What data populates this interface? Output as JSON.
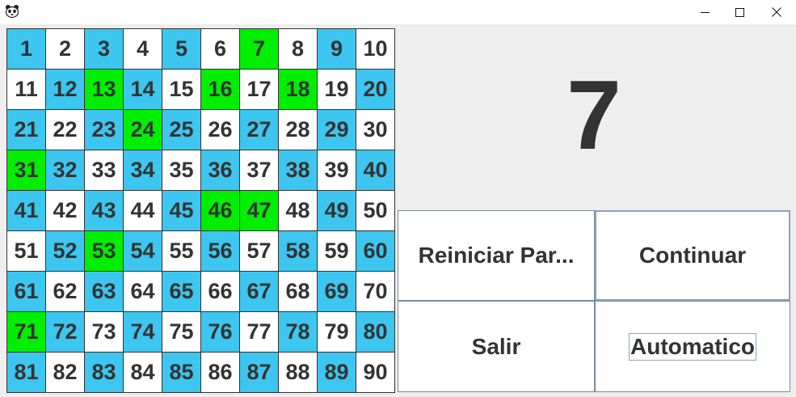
{
  "window": {
    "app_icon": "panda-icon",
    "minimize_icon": "minimize-icon",
    "maximize_icon": "maximize-icon",
    "close_icon": "close-icon"
  },
  "colors": {
    "called": "#00ee00",
    "blue": "#3dc6ef",
    "white": "#ffffff",
    "text": "#333333"
  },
  "board": {
    "cells": [
      {
        "n": "1",
        "s": "blue"
      },
      {
        "n": "2",
        "s": "white"
      },
      {
        "n": "3",
        "s": "blue"
      },
      {
        "n": "4",
        "s": "white"
      },
      {
        "n": "5",
        "s": "blue"
      },
      {
        "n": "6",
        "s": "white"
      },
      {
        "n": "7",
        "s": "called"
      },
      {
        "n": "8",
        "s": "white"
      },
      {
        "n": "9",
        "s": "blue"
      },
      {
        "n": "10",
        "s": "white"
      },
      {
        "n": "11",
        "s": "white"
      },
      {
        "n": "12",
        "s": "blue"
      },
      {
        "n": "13",
        "s": "called"
      },
      {
        "n": "14",
        "s": "blue"
      },
      {
        "n": "15",
        "s": "white"
      },
      {
        "n": "16",
        "s": "called"
      },
      {
        "n": "17",
        "s": "white"
      },
      {
        "n": "18",
        "s": "called"
      },
      {
        "n": "19",
        "s": "white"
      },
      {
        "n": "20",
        "s": "blue"
      },
      {
        "n": "21",
        "s": "blue"
      },
      {
        "n": "22",
        "s": "white"
      },
      {
        "n": "23",
        "s": "blue"
      },
      {
        "n": "24",
        "s": "called"
      },
      {
        "n": "25",
        "s": "blue"
      },
      {
        "n": "26",
        "s": "white"
      },
      {
        "n": "27",
        "s": "blue"
      },
      {
        "n": "28",
        "s": "white"
      },
      {
        "n": "29",
        "s": "blue"
      },
      {
        "n": "30",
        "s": "white"
      },
      {
        "n": "31",
        "s": "called"
      },
      {
        "n": "32",
        "s": "blue"
      },
      {
        "n": "33",
        "s": "white"
      },
      {
        "n": "34",
        "s": "blue"
      },
      {
        "n": "35",
        "s": "white"
      },
      {
        "n": "36",
        "s": "blue"
      },
      {
        "n": "37",
        "s": "white"
      },
      {
        "n": "38",
        "s": "blue"
      },
      {
        "n": "39",
        "s": "white"
      },
      {
        "n": "40",
        "s": "blue"
      },
      {
        "n": "41",
        "s": "blue"
      },
      {
        "n": "42",
        "s": "white"
      },
      {
        "n": "43",
        "s": "blue"
      },
      {
        "n": "44",
        "s": "white"
      },
      {
        "n": "45",
        "s": "blue"
      },
      {
        "n": "46",
        "s": "called"
      },
      {
        "n": "47",
        "s": "called"
      },
      {
        "n": "48",
        "s": "white"
      },
      {
        "n": "49",
        "s": "blue"
      },
      {
        "n": "50",
        "s": "white"
      },
      {
        "n": "51",
        "s": "white"
      },
      {
        "n": "52",
        "s": "blue"
      },
      {
        "n": "53",
        "s": "called"
      },
      {
        "n": "54",
        "s": "blue"
      },
      {
        "n": "55",
        "s": "white"
      },
      {
        "n": "56",
        "s": "blue"
      },
      {
        "n": "57",
        "s": "white"
      },
      {
        "n": "58",
        "s": "blue"
      },
      {
        "n": "59",
        "s": "white"
      },
      {
        "n": "60",
        "s": "blue"
      },
      {
        "n": "61",
        "s": "blue"
      },
      {
        "n": "62",
        "s": "white"
      },
      {
        "n": "63",
        "s": "blue"
      },
      {
        "n": "64",
        "s": "white"
      },
      {
        "n": "65",
        "s": "blue"
      },
      {
        "n": "66",
        "s": "white"
      },
      {
        "n": "67",
        "s": "blue"
      },
      {
        "n": "68",
        "s": "white"
      },
      {
        "n": "69",
        "s": "blue"
      },
      {
        "n": "70",
        "s": "white"
      },
      {
        "n": "71",
        "s": "called"
      },
      {
        "n": "72",
        "s": "blue"
      },
      {
        "n": "73",
        "s": "white"
      },
      {
        "n": "74",
        "s": "blue"
      },
      {
        "n": "75",
        "s": "white"
      },
      {
        "n": "76",
        "s": "blue"
      },
      {
        "n": "77",
        "s": "white"
      },
      {
        "n": "78",
        "s": "blue"
      },
      {
        "n": "79",
        "s": "white"
      },
      {
        "n": "80",
        "s": "blue"
      },
      {
        "n": "81",
        "s": "blue"
      },
      {
        "n": "82",
        "s": "white"
      },
      {
        "n": "83",
        "s": "blue"
      },
      {
        "n": "84",
        "s": "white"
      },
      {
        "n": "85",
        "s": "blue"
      },
      {
        "n": "86",
        "s": "white"
      },
      {
        "n": "87",
        "s": "blue"
      },
      {
        "n": "88",
        "s": "white"
      },
      {
        "n": "89",
        "s": "blue"
      },
      {
        "n": "90",
        "s": "white"
      }
    ]
  },
  "current_number": "7",
  "buttons": {
    "restart": "Reiniciar Par...",
    "continue": "Continuar",
    "exit": "Salir",
    "auto": "Automatico"
  }
}
